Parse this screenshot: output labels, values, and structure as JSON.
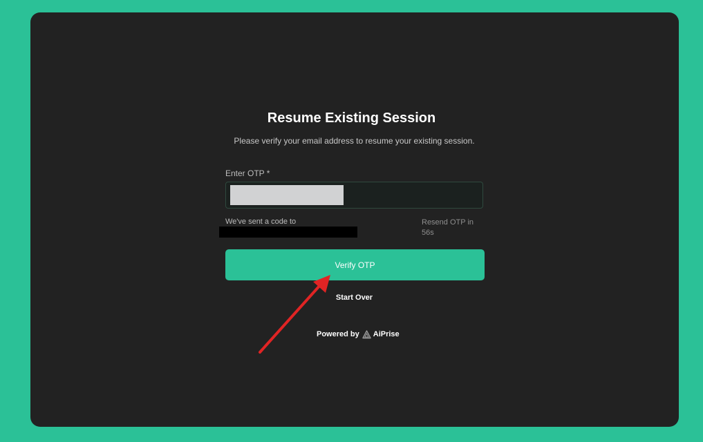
{
  "session": {
    "title": "Resume Existing Session",
    "subtitle": "Please verify your email address to resume your existing session."
  },
  "otp": {
    "label": "Enter OTP *",
    "value": "",
    "sent_text": "We've sent a code to",
    "resend_text": "Resend OTP in 56s"
  },
  "actions": {
    "verify_label": "Verify OTP",
    "start_over_label": "Start Over"
  },
  "footer": {
    "powered_by": "Powered by",
    "brand": "AiPrise"
  },
  "colors": {
    "background": "#2bc197",
    "card": "#222222",
    "accent": "#2bc197",
    "annotation_arrow": "#e02424"
  },
  "icons": {
    "brand_logo": "aiprise-logo-icon",
    "annotation": "red-arrow-annotation"
  }
}
